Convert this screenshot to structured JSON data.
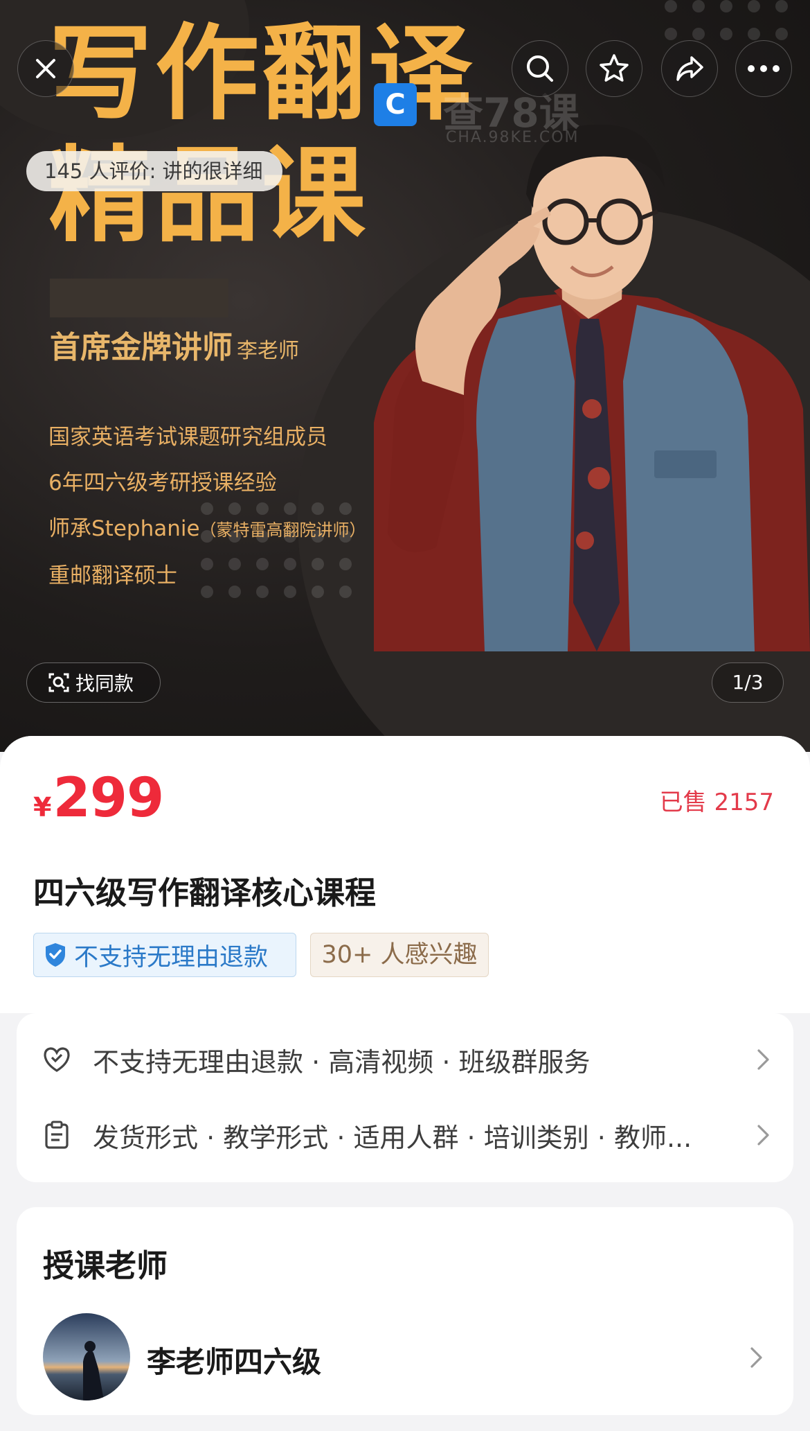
{
  "hero": {
    "title_line1": "写作翻译",
    "title_line2": "精品课",
    "teacher_title": "首席金牌讲师",
    "teacher_name": "李老师",
    "bullets": [
      "国家英语考试课题研究组成员",
      "6年四六级考研授课经验",
      "师承Stephanie",
      "重邮翻译硕士"
    ],
    "bullet3_note": "（蒙特雷高翻院讲师）",
    "watermark_text": "查78课",
    "watermark_sub": "CHA.98KE.COM",
    "review_count_label": "145 人评价: 讲的很详细",
    "find_similar": "找同款",
    "page_indicator": "1/3"
  },
  "icons": {
    "close": "close-icon",
    "search": "search-icon",
    "favorite": "star-icon",
    "share": "share-icon",
    "more": "more-icon"
  },
  "product": {
    "currency": "¥",
    "price": "299",
    "sold": "已售 2157",
    "title": "四六级写作翻译核心课程",
    "tag_refund": "不支持无理由退款",
    "tag_interest": "30+ 人感兴趣"
  },
  "services": {
    "row1": "不支持无理由退款 · 高清视频 · 班级群服务",
    "row2": "发货形式 · 教学形式 · 适用人群 · 培训类别 · 教师..."
  },
  "teacher_section": {
    "heading": "授课老师",
    "name": "李老师四六级"
  },
  "colors": {
    "price_red": "#ee2a3a",
    "hero_gold": "#f4b248",
    "refund_blue": "#2a79c8"
  }
}
